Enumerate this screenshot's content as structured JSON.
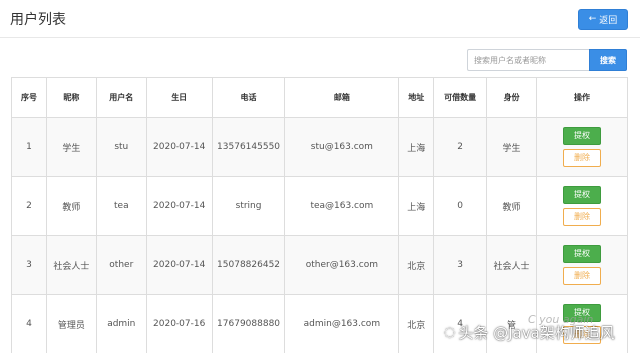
{
  "header": {
    "title": "用户列表",
    "back_label": "返回",
    "back_icon": "arrow-left-icon"
  },
  "search": {
    "placeholder": "搜索用户名或者昵称",
    "button_label": "搜索"
  },
  "table": {
    "columns": [
      "序号",
      "昵称",
      "用户名",
      "生日",
      "电话",
      "邮箱",
      "地址",
      "可借数量",
      "身份",
      "操作"
    ],
    "rows": [
      {
        "index": "1",
        "nickname": "学生",
        "username": "stu",
        "birthday": "2020-07-14",
        "phone": "13576145550",
        "email": "stu@163.com",
        "address": "上海",
        "borrow": "2",
        "role": "学生"
      },
      {
        "index": "2",
        "nickname": "教师",
        "username": "tea",
        "birthday": "2020-07-14",
        "phone": "string",
        "email": "tea@163.com",
        "address": "上海",
        "borrow": "0",
        "role": "教师"
      },
      {
        "index": "3",
        "nickname": "社会人士",
        "username": "other",
        "birthday": "2020-07-14",
        "phone": "15078826452",
        "email": "other@163.com",
        "address": "北京",
        "borrow": "3",
        "role": "社会人士"
      },
      {
        "index": "4",
        "nickname": "管理员",
        "username": "admin",
        "birthday": "2020-07-16",
        "phone": "17679088880",
        "email": "admin@163.com",
        "address": "北京",
        "borrow": "4",
        "role": "管"
      }
    ],
    "auth_label": "提权",
    "delete_label": "删除"
  },
  "watermark": {
    "text": "头条 @Java架构师追风",
    "faint_text": "C you again",
    "icon": "wechat-icon"
  },
  "colors": {
    "primary": "#3a8ee6",
    "success": "#4cae4c",
    "warning": "#f0ad4e"
  }
}
